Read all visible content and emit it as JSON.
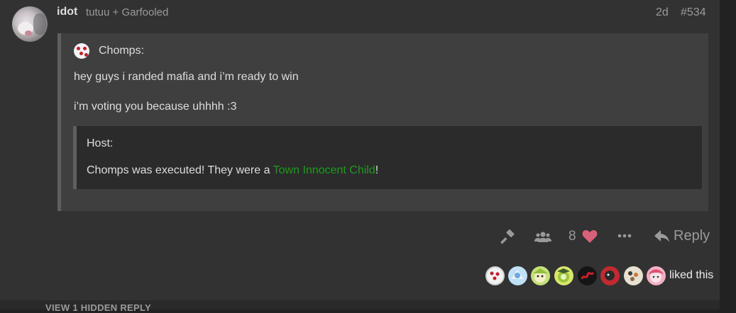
{
  "post": {
    "username": "idot",
    "group": "tutuu + Garfooled",
    "date": "2d",
    "number": "#534"
  },
  "quote": {
    "author": "Chomps:",
    "line1": "hey guys i randed mafia and i’m ready to win",
    "line2": "i’m voting you because uhhhh :3",
    "nested": {
      "author": "Host:",
      "text_before": "Chomps was executed! They were a ",
      "role": "Town Innocent Child",
      "text_after": "!",
      "role_color": "#1f9a1f"
    }
  },
  "actions": {
    "like_count": "8",
    "reply_label": "Reply",
    "heart_color": "#d9607a"
  },
  "likers": {
    "avatars": [
      "liker-avatar",
      "liker-avatar",
      "liker-avatar",
      "liker-avatar",
      "liker-avatar",
      "liker-avatar",
      "liker-avatar",
      "liker-avatar"
    ],
    "label": "liked this"
  },
  "footer": {
    "hidden_reply": "VIEW 1 HIDDEN REPLY"
  }
}
